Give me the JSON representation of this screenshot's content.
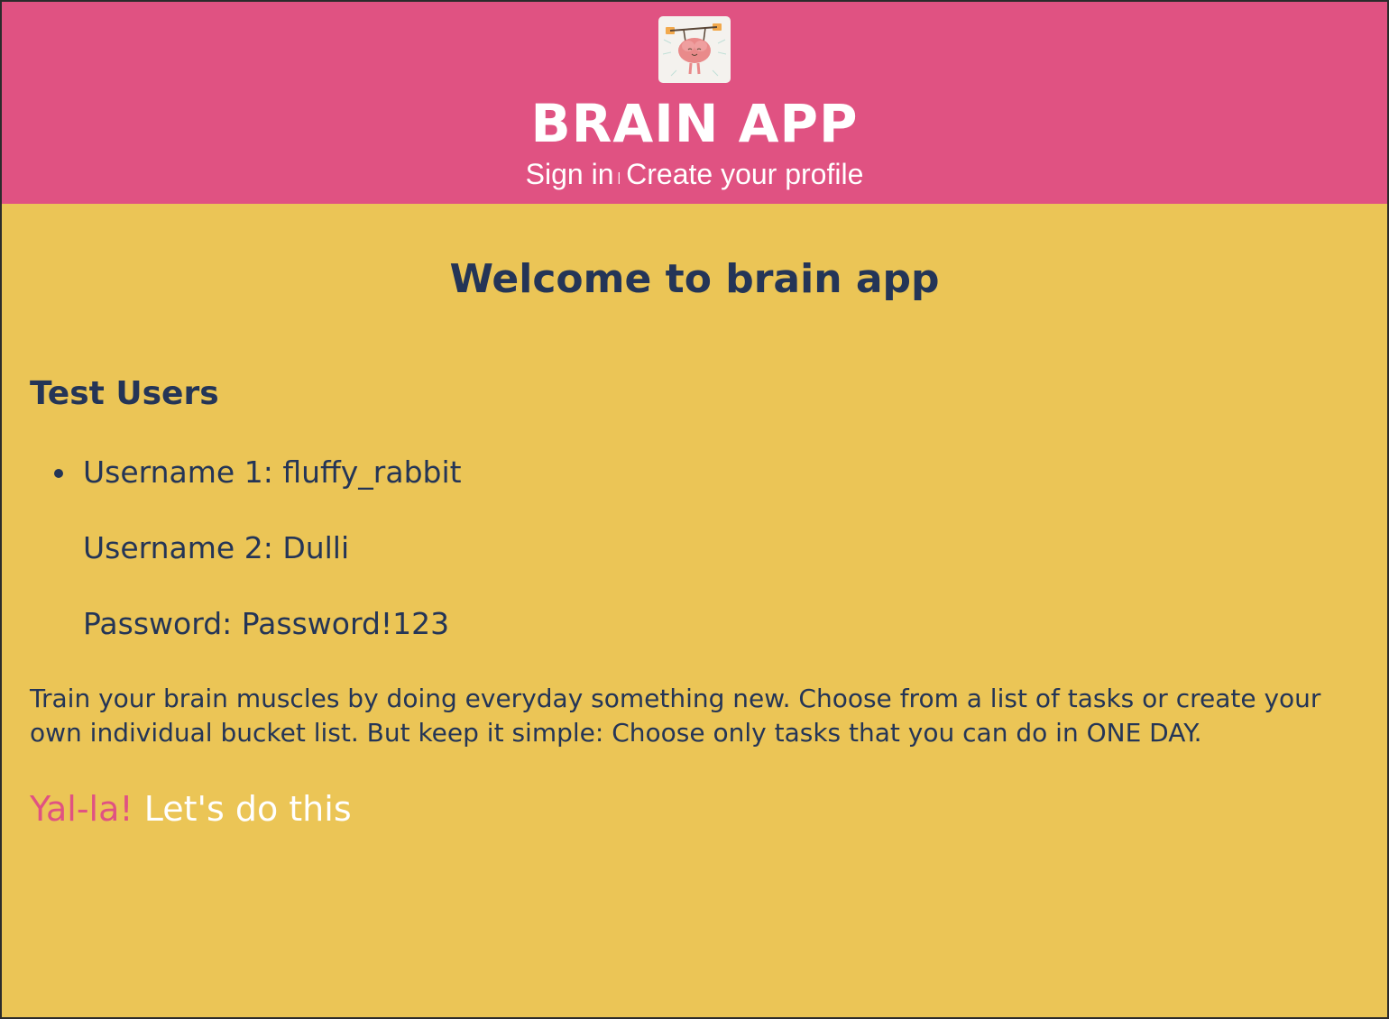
{
  "header": {
    "logo_icon": "brain-lifting-weights-icon",
    "title": "BRAIN APP",
    "nav": {
      "sign_in": "Sign in",
      "separator": "|",
      "create_profile": "Create your profile"
    }
  },
  "main": {
    "welcome": "Welcome to brain app",
    "test_users": {
      "title": "Test Users",
      "lines": [
        "Username 1: fluffy_rabbit",
        "Username 2: Dulli",
        "Password: Password!123"
      ]
    },
    "description": "Train your brain muscles by doing everyday something new. Choose from a list of tasks or create your own individual bucket list. But keep it simple: Choose only tasks that you can do in ONE DAY.",
    "cta": {
      "highlight": "Yal-la!",
      "text": "Let's do this"
    }
  },
  "colors": {
    "header_bg": "#e05282",
    "page_bg": "#ebc556",
    "text": "#243557",
    "accent": "#e05282"
  }
}
